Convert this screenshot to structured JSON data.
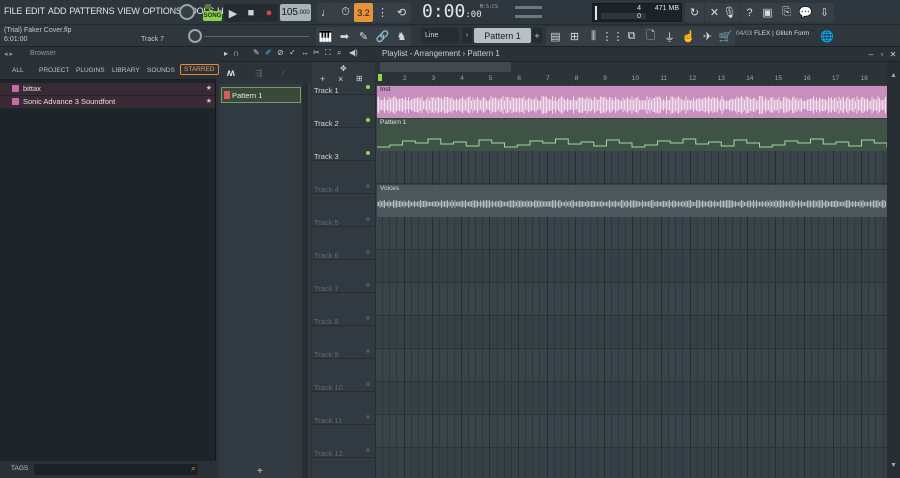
{
  "menu": [
    "FILE",
    "EDIT",
    "ADD",
    "PATTERNS",
    "VIEW",
    "OPTIONS",
    "TOOLS",
    "HELP"
  ],
  "transport": {
    "mode_label": "SONG",
    "tempo_int": "105",
    "tempo_frac": ".000",
    "time_main": "0:00",
    "time_sub": ":00",
    "time_sig": "M:S:CS"
  },
  "monitor": {
    "cpu_value": "4",
    "mem_value": "471 MB",
    "poly_value": "0"
  },
  "hint": {
    "project": "(Trial) Faker Cover.flp",
    "time": "6:01:00",
    "track": "Track 7"
  },
  "toolbar2": {
    "snap": "Line",
    "pattern": "Pattern 1",
    "news_date": "04/03",
    "news_text": "FLEX | Glitch Form"
  },
  "browser": {
    "title": "Browser",
    "tabs": [
      "ALL",
      "PROJECT",
      "PLUGINS",
      "LIBRARY",
      "SOUNDS",
      "STARRED"
    ],
    "active_tab": "STARRED",
    "items": [
      {
        "label": "bittax"
      },
      {
        "label": "Sonic Advance 3 Soundfont"
      }
    ],
    "footer": "TAGS"
  },
  "picker": {
    "patterns": [
      {
        "label": "Pattern 1"
      }
    ]
  },
  "playlist": {
    "title": "Playlist - Arrangement",
    "pattern": "Pattern 1",
    "tracks": [
      "Track 1",
      "Track 2",
      "Track 3",
      "Track 4",
      "Track 5",
      "Track 6",
      "Track 7",
      "Track 8",
      "Track 9",
      "Track 10",
      "Track 11",
      "Track 12"
    ],
    "bars": [
      "2",
      "3",
      "4",
      "5",
      "6",
      "7",
      "8",
      "9",
      "10",
      "11",
      "12",
      "13",
      "14",
      "15",
      "16",
      "17",
      "18"
    ],
    "clips": [
      {
        "label": "Inst"
      },
      {
        "label": "Pattern 1"
      },
      {
        "label": "Voices"
      }
    ]
  }
}
